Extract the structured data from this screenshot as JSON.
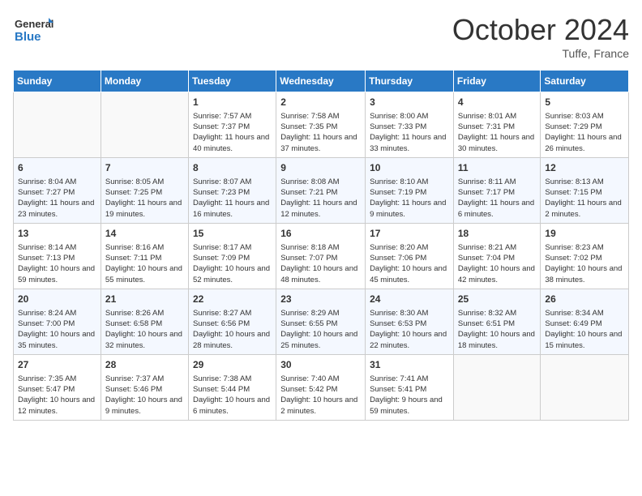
{
  "header": {
    "logo_line1": "General",
    "logo_line2": "Blue",
    "month": "October 2024",
    "location": "Tuffe, France"
  },
  "days_of_week": [
    "Sunday",
    "Monday",
    "Tuesday",
    "Wednesday",
    "Thursday",
    "Friday",
    "Saturday"
  ],
  "weeks": [
    [
      {
        "day": "",
        "sunrise": "",
        "sunset": "",
        "daylight": "",
        "empty": true
      },
      {
        "day": "",
        "sunrise": "",
        "sunset": "",
        "daylight": "",
        "empty": true
      },
      {
        "day": "1",
        "sunrise": "Sunrise: 7:57 AM",
        "sunset": "Sunset: 7:37 PM",
        "daylight": "Daylight: 11 hours and 40 minutes.",
        "empty": false
      },
      {
        "day": "2",
        "sunrise": "Sunrise: 7:58 AM",
        "sunset": "Sunset: 7:35 PM",
        "daylight": "Daylight: 11 hours and 37 minutes.",
        "empty": false
      },
      {
        "day": "3",
        "sunrise": "Sunrise: 8:00 AM",
        "sunset": "Sunset: 7:33 PM",
        "daylight": "Daylight: 11 hours and 33 minutes.",
        "empty": false
      },
      {
        "day": "4",
        "sunrise": "Sunrise: 8:01 AM",
        "sunset": "Sunset: 7:31 PM",
        "daylight": "Daylight: 11 hours and 30 minutes.",
        "empty": false
      },
      {
        "day": "5",
        "sunrise": "Sunrise: 8:03 AM",
        "sunset": "Sunset: 7:29 PM",
        "daylight": "Daylight: 11 hours and 26 minutes.",
        "empty": false
      }
    ],
    [
      {
        "day": "6",
        "sunrise": "Sunrise: 8:04 AM",
        "sunset": "Sunset: 7:27 PM",
        "daylight": "Daylight: 11 hours and 23 minutes.",
        "empty": false
      },
      {
        "day": "7",
        "sunrise": "Sunrise: 8:05 AM",
        "sunset": "Sunset: 7:25 PM",
        "daylight": "Daylight: 11 hours and 19 minutes.",
        "empty": false
      },
      {
        "day": "8",
        "sunrise": "Sunrise: 8:07 AM",
        "sunset": "Sunset: 7:23 PM",
        "daylight": "Daylight: 11 hours and 16 minutes.",
        "empty": false
      },
      {
        "day": "9",
        "sunrise": "Sunrise: 8:08 AM",
        "sunset": "Sunset: 7:21 PM",
        "daylight": "Daylight: 11 hours and 12 minutes.",
        "empty": false
      },
      {
        "day": "10",
        "sunrise": "Sunrise: 8:10 AM",
        "sunset": "Sunset: 7:19 PM",
        "daylight": "Daylight: 11 hours and 9 minutes.",
        "empty": false
      },
      {
        "day": "11",
        "sunrise": "Sunrise: 8:11 AM",
        "sunset": "Sunset: 7:17 PM",
        "daylight": "Daylight: 11 hours and 6 minutes.",
        "empty": false
      },
      {
        "day": "12",
        "sunrise": "Sunrise: 8:13 AM",
        "sunset": "Sunset: 7:15 PM",
        "daylight": "Daylight: 11 hours and 2 minutes.",
        "empty": false
      }
    ],
    [
      {
        "day": "13",
        "sunrise": "Sunrise: 8:14 AM",
        "sunset": "Sunset: 7:13 PM",
        "daylight": "Daylight: 10 hours and 59 minutes.",
        "empty": false
      },
      {
        "day": "14",
        "sunrise": "Sunrise: 8:16 AM",
        "sunset": "Sunset: 7:11 PM",
        "daylight": "Daylight: 10 hours and 55 minutes.",
        "empty": false
      },
      {
        "day": "15",
        "sunrise": "Sunrise: 8:17 AM",
        "sunset": "Sunset: 7:09 PM",
        "daylight": "Daylight: 10 hours and 52 minutes.",
        "empty": false
      },
      {
        "day": "16",
        "sunrise": "Sunrise: 8:18 AM",
        "sunset": "Sunset: 7:07 PM",
        "daylight": "Daylight: 10 hours and 48 minutes.",
        "empty": false
      },
      {
        "day": "17",
        "sunrise": "Sunrise: 8:20 AM",
        "sunset": "Sunset: 7:06 PM",
        "daylight": "Daylight: 10 hours and 45 minutes.",
        "empty": false
      },
      {
        "day": "18",
        "sunrise": "Sunrise: 8:21 AM",
        "sunset": "Sunset: 7:04 PM",
        "daylight": "Daylight: 10 hours and 42 minutes.",
        "empty": false
      },
      {
        "day": "19",
        "sunrise": "Sunrise: 8:23 AM",
        "sunset": "Sunset: 7:02 PM",
        "daylight": "Daylight: 10 hours and 38 minutes.",
        "empty": false
      }
    ],
    [
      {
        "day": "20",
        "sunrise": "Sunrise: 8:24 AM",
        "sunset": "Sunset: 7:00 PM",
        "daylight": "Daylight: 10 hours and 35 minutes.",
        "empty": false
      },
      {
        "day": "21",
        "sunrise": "Sunrise: 8:26 AM",
        "sunset": "Sunset: 6:58 PM",
        "daylight": "Daylight: 10 hours and 32 minutes.",
        "empty": false
      },
      {
        "day": "22",
        "sunrise": "Sunrise: 8:27 AM",
        "sunset": "Sunset: 6:56 PM",
        "daylight": "Daylight: 10 hours and 28 minutes.",
        "empty": false
      },
      {
        "day": "23",
        "sunrise": "Sunrise: 8:29 AM",
        "sunset": "Sunset: 6:55 PM",
        "daylight": "Daylight: 10 hours and 25 minutes.",
        "empty": false
      },
      {
        "day": "24",
        "sunrise": "Sunrise: 8:30 AM",
        "sunset": "Sunset: 6:53 PM",
        "daylight": "Daylight: 10 hours and 22 minutes.",
        "empty": false
      },
      {
        "day": "25",
        "sunrise": "Sunrise: 8:32 AM",
        "sunset": "Sunset: 6:51 PM",
        "daylight": "Daylight: 10 hours and 18 minutes.",
        "empty": false
      },
      {
        "day": "26",
        "sunrise": "Sunrise: 8:34 AM",
        "sunset": "Sunset: 6:49 PM",
        "daylight": "Daylight: 10 hours and 15 minutes.",
        "empty": false
      }
    ],
    [
      {
        "day": "27",
        "sunrise": "Sunrise: 7:35 AM",
        "sunset": "Sunset: 5:47 PM",
        "daylight": "Daylight: 10 hours and 12 minutes.",
        "empty": false
      },
      {
        "day": "28",
        "sunrise": "Sunrise: 7:37 AM",
        "sunset": "Sunset: 5:46 PM",
        "daylight": "Daylight: 10 hours and 9 minutes.",
        "empty": false
      },
      {
        "day": "29",
        "sunrise": "Sunrise: 7:38 AM",
        "sunset": "Sunset: 5:44 PM",
        "daylight": "Daylight: 10 hours and 6 minutes.",
        "empty": false
      },
      {
        "day": "30",
        "sunrise": "Sunrise: 7:40 AM",
        "sunset": "Sunset: 5:42 PM",
        "daylight": "Daylight: 10 hours and 2 minutes.",
        "empty": false
      },
      {
        "day": "31",
        "sunrise": "Sunrise: 7:41 AM",
        "sunset": "Sunset: 5:41 PM",
        "daylight": "Daylight: 9 hours and 59 minutes.",
        "empty": false
      },
      {
        "day": "",
        "sunrise": "",
        "sunset": "",
        "daylight": "",
        "empty": true
      },
      {
        "day": "",
        "sunrise": "",
        "sunset": "",
        "daylight": "",
        "empty": true
      }
    ]
  ]
}
